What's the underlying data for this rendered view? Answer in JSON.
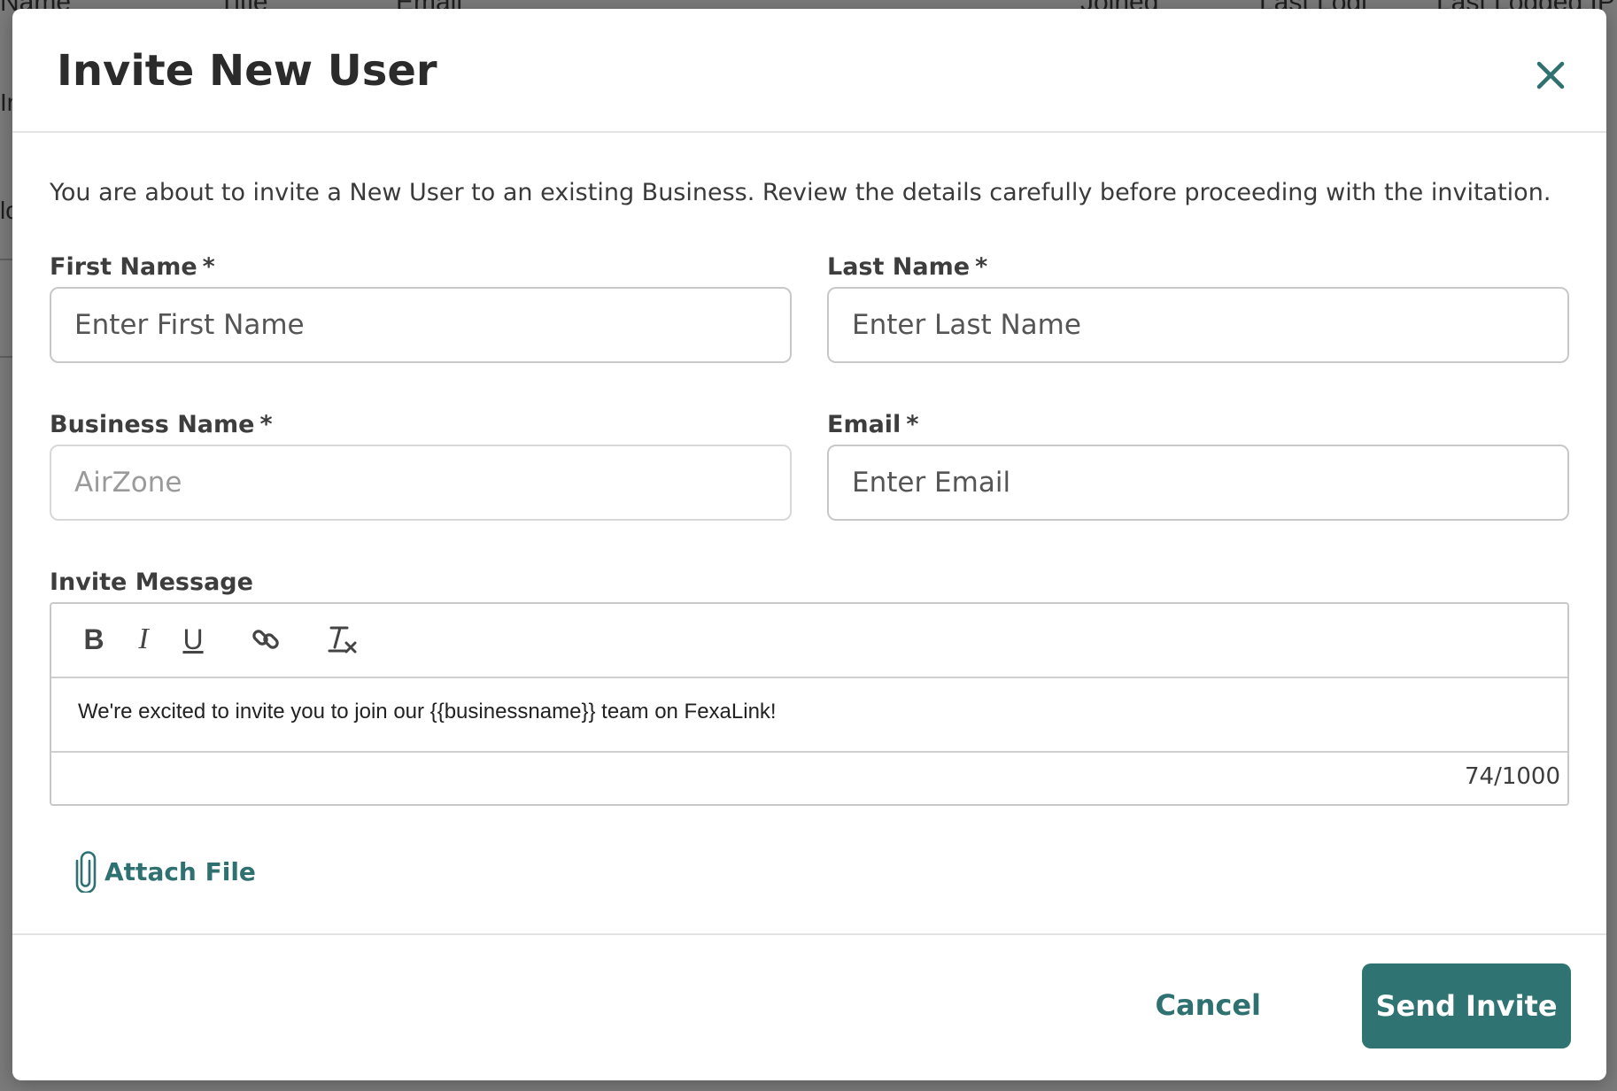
{
  "background": {
    "headers": [
      "Name",
      "Title",
      "Email",
      "Joined",
      "Last Logi",
      "Last Logged IP"
    ],
    "fragments": [
      "In",
      "lo"
    ]
  },
  "modal": {
    "title": "Invite New User",
    "close_icon": "close-icon",
    "intro": "You are about to invite a New User to an existing Business. Review the details carefully before proceeding with the invitation.",
    "fields": {
      "first_name": {
        "label": "First Name",
        "required": "*",
        "placeholder": "Enter First Name"
      },
      "last_name": {
        "label": "Last Name",
        "required": "*",
        "placeholder": "Enter Last Name"
      },
      "business_name": {
        "label": "Business Name",
        "required": "*",
        "value": "AirZone"
      },
      "email": {
        "label": "Email",
        "required": "*",
        "placeholder": "Enter Email"
      }
    },
    "invite_message": {
      "label": "Invite Message",
      "toolbar": {
        "bold": "B",
        "italic": "I",
        "underline": "U",
        "link_icon": "link-icon",
        "clear_format_icon": "clear-format-icon"
      },
      "body": "We're excited to invite you to join our {{businessname}} team on FexaLink!",
      "counter": "74/1000"
    },
    "attach": {
      "label": "Attach File",
      "icon": "paperclip-icon"
    },
    "footer": {
      "cancel": "Cancel",
      "send": "Send Invite"
    }
  },
  "colors": {
    "accent": "#2f7472",
    "accent_text": "#2e7170"
  }
}
